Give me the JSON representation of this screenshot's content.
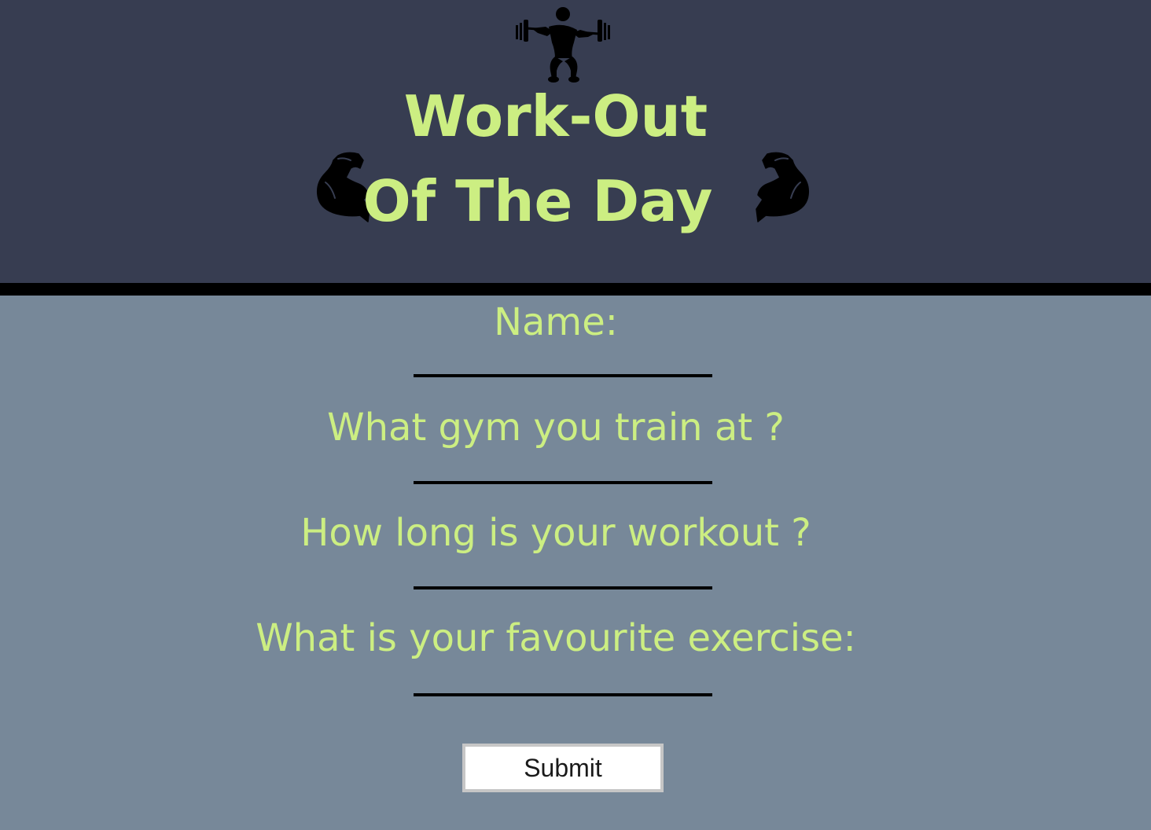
{
  "header": {
    "title_line1": "Work-Out",
    "title_line2": "Of The Day",
    "icons": [
      "weightlifter-icon",
      "flexed-biceps-left-icon",
      "flexed-biceps-right-icon"
    ]
  },
  "form": {
    "name_label": "Name:",
    "name_value": "",
    "gym_label": "What gym you train at ?",
    "gym_value": "",
    "duration_label": "How long is your workout ?",
    "duration_value": "",
    "exercise_label": "What is your favourite exercise:",
    "exercise_value": "",
    "submit_label": "Submit"
  },
  "colors": {
    "header_background": "#373d51",
    "page_background": "#778899",
    "accent_text": "#ccee82",
    "divider": "#000000"
  }
}
